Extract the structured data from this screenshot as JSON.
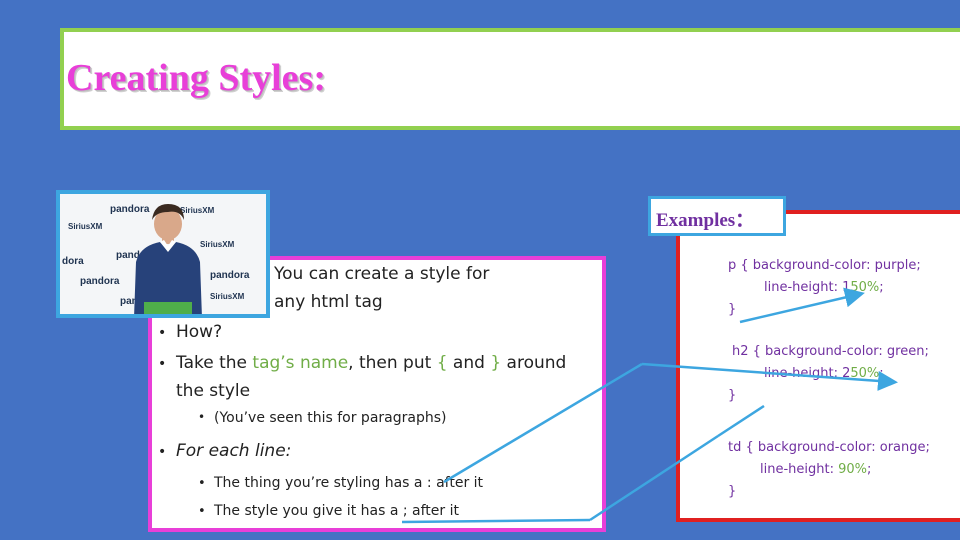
{
  "title": "Creating Styles:",
  "photo": {
    "logos": [
      "pandora",
      "SiriusXM",
      "pandora",
      "SiriusXM",
      "pandora",
      "SiriusXM",
      "pandora",
      "dora",
      "pandora",
      "SiriusXM"
    ]
  },
  "left_panel": {
    "intro_line1": "You can create a style for",
    "intro_line2": "any html tag",
    "how": "How?",
    "take_prefix": "Take the ",
    "take_tagname": "tag’s name",
    "take_mid1": ", then put ",
    "take_open": "{",
    "take_and": " and ",
    "take_close": "}",
    "take_suffix": " around",
    "take_line2": "the style",
    "seen": "(You’ve seen this for paragraphs)",
    "for_each": "For each line:",
    "thing": "The thing you’re styling has a : after it",
    "style": "The style you give it has a ; after it",
    "bullet": "•"
  },
  "right_panel": {
    "examples_label": "Examples：",
    "p_line1": "p { background-color: purple;",
    "p_line2a": "line-height: 1",
    "p_line2b": "50%",
    "p_line2c": ";",
    "p_close": "}",
    "h2_line1": "h2 { background-color: green;",
    "h2_line2a": "line-height: 2",
    "h2_line2b": "50%",
    "h2_line2c": ";",
    "h2_close": "}",
    "td_line1": "td {  background-color: orange;",
    "td_line2a": "line-height: ",
    "td_line2b": "90%",
    "td_line2c": ";",
    "td_close": "}"
  },
  "colors": {
    "background": "#4472c4",
    "title": "#e83fd8",
    "title_border": "#92d050",
    "left_border": "#e83fd8",
    "right_border": "#e02020",
    "accent_green": "#70ad47",
    "code_purple": "#7030a0",
    "arrow": "#3da6e0"
  }
}
